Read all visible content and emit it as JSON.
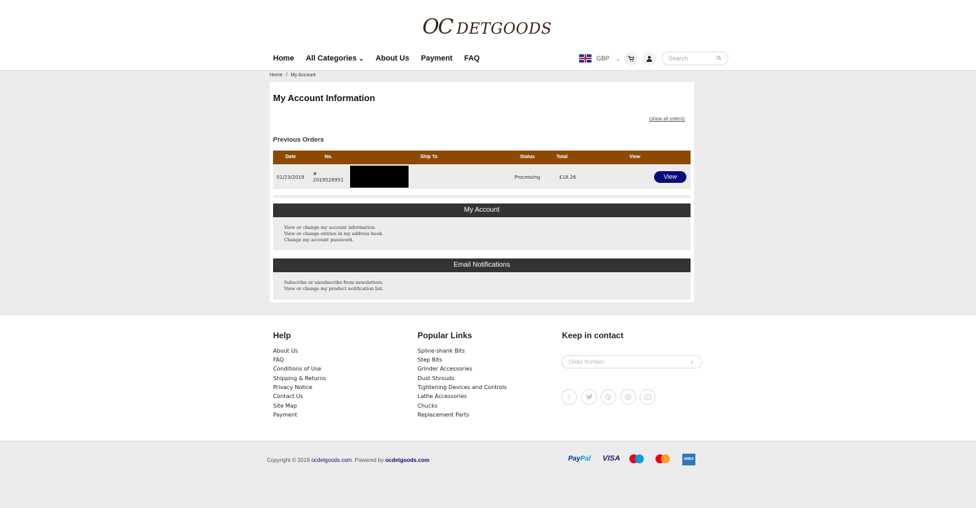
{
  "header": {
    "logo_big": "OC",
    "logo_small": "DETGOODS",
    "nav": [
      {
        "label": "Home"
      },
      {
        "label": "All Categories"
      },
      {
        "label": "About Us"
      },
      {
        "label": "Payment"
      },
      {
        "label": "FAQ"
      }
    ],
    "currency": "GBP",
    "search_placeholder": "Search"
  },
  "breadcrumb": [
    "Home",
    "My Account"
  ],
  "page_title": "My Account Information",
  "show_all_orders": "(show all orders)",
  "previous_orders": {
    "title": "Previous Orders",
    "columns": [
      "Date",
      "No.",
      "Ship To",
      "Status",
      "Total",
      "View"
    ],
    "rows": [
      {
        "date": "01/23/2019",
        "no_hash": "#",
        "no": "2019526951",
        "ship_to": "",
        "status": "Processing",
        "total": "£18.26",
        "view": "View"
      }
    ]
  },
  "my_account": {
    "title": "My Account",
    "lines": [
      "View or change my account information.",
      "View or change entries in my address book.",
      "Change my account password."
    ]
  },
  "email_notifications": {
    "title": "Email Notifications",
    "lines": [
      "Subscribe or unsubscribe from newsletters.",
      "View or change my product notification list."
    ]
  },
  "footer": {
    "help": {
      "title": "Help",
      "links": [
        "About Us",
        "FAQ",
        "Conditions of Use",
        "Shipping & Returns",
        "Privacy Notice",
        "Contact Us",
        "Site Map",
        "Payment"
      ]
    },
    "popular": {
      "title": "Popular Links",
      "links": [
        "Spline-shank Bits",
        "Step Bits",
        "Grinder Accessories",
        "Dust Shrouds",
        "Tightening Devices and Controls",
        "Lathe Accessories",
        "Chucks",
        "Replacement Parts"
      ]
    },
    "contact": {
      "title": "Keep in contact",
      "order_placeholder": "Order Number:"
    },
    "social_icons": [
      "facebook-icon",
      "twitter-icon",
      "pinterest-icon",
      "instagram-icon",
      "youtube-icon"
    ]
  },
  "bottom": {
    "copyright_prefix": "Copyright © 2019 ",
    "site_link": "ocdetgoods.com",
    "powered_text": ". Powered by ",
    "powered_link": "ocdetgoods.com",
    "paypal_p": "PayPal",
    "visa": "VISA",
    "amex": "AMERICAN EXPRESS"
  },
  "colors": {
    "brand_brown": "#8b4a04",
    "button_navy": "#0a0a7a",
    "section_dark": "#333333"
  }
}
